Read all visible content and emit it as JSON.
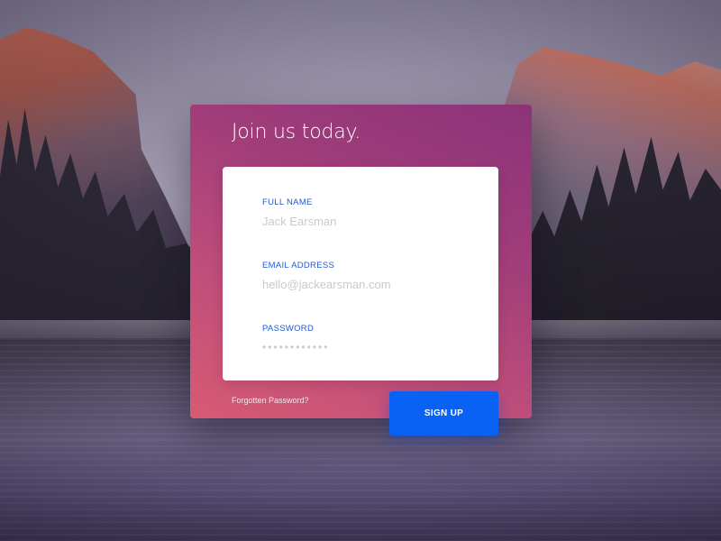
{
  "card": {
    "title": "Join us today."
  },
  "form": {
    "full_name": {
      "label": "FULL NAME",
      "placeholder": "Jack Earsman"
    },
    "email": {
      "label": "EMAIL ADDRESS",
      "placeholder": "hello@jackearsman.com"
    },
    "password": {
      "label": "PASSWORD",
      "placeholder": "••••••••••••"
    }
  },
  "actions": {
    "forgot_label": "Forgotten Password?",
    "signup_label": "SIGN UP"
  },
  "colors": {
    "accent": "#0a62f5",
    "label": "#1f5ad3",
    "card_gradient_start": "#8c3379",
    "card_gradient_end": "#d85a74"
  }
}
